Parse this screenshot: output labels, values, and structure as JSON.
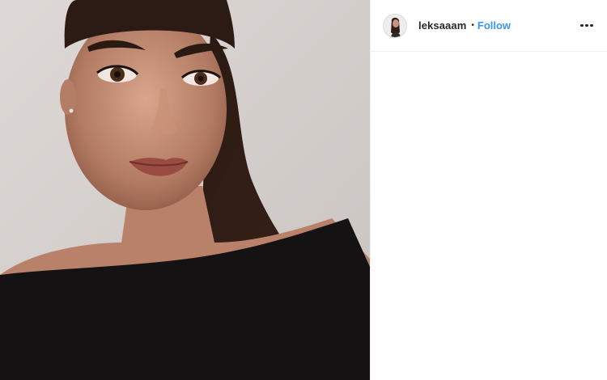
{
  "post": {
    "author": {
      "username": "leksaaam",
      "separator": "•",
      "follow_label": "Follow"
    },
    "menu_icon": "more-horizontal-icon",
    "photo_description_icon": "photo"
  },
  "colors": {
    "follow_blue": "#3897f0",
    "text_dark": "#262626",
    "divider": "#efefef"
  }
}
